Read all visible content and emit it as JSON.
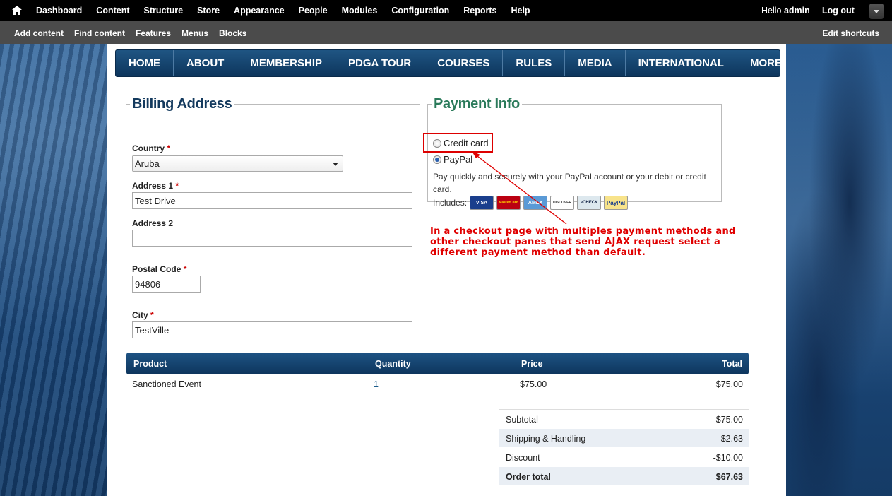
{
  "toolbar": {
    "menu": [
      "Dashboard",
      "Content",
      "Structure",
      "Store",
      "Appearance",
      "People",
      "Modules",
      "Configuration",
      "Reports",
      "Help"
    ],
    "hello": "Hello ",
    "username": "admin",
    "logout": "Log out"
  },
  "shortcuts": {
    "links": [
      "Add content",
      "Find content",
      "Features",
      "Menus",
      "Blocks"
    ],
    "edit": "Edit shortcuts"
  },
  "nav": [
    "HOME",
    "ABOUT",
    "MEMBERSHIP",
    "PDGA TOUR",
    "COURSES",
    "RULES",
    "MEDIA",
    "INTERNATIONAL",
    "MORE"
  ],
  "billing": {
    "legend": "Billing Address",
    "country_label": "Country",
    "country_value": "Aruba",
    "address1_label": "Address 1",
    "address1_value": "Test Drive",
    "address2_label": "Address 2",
    "address2_value": "",
    "postal_label": "Postal Code",
    "postal_value": "94806",
    "city_label": "City",
    "city_value": "TestVille",
    "required_mark": "*"
  },
  "payment": {
    "legend": "Payment Info",
    "options": [
      "Credit card",
      "PayPal"
    ],
    "selected": "PayPal",
    "description": "Pay quickly and securely with your PayPal account or your debit or credit card.",
    "includes_label": "Includes:",
    "cards": [
      "VISA",
      "MasterCard",
      "AMEX",
      "DISCOVER",
      "eCHECK",
      "PayPal"
    ]
  },
  "annotation": "In a checkout page with multiples payment methods and other checkout panes that send AJAX request select a different payment method than default.",
  "products": {
    "headers": [
      "Product",
      "Quantity",
      "Price",
      "Total"
    ],
    "rows": [
      {
        "product": "Sanctioned Event",
        "quantity": "1",
        "price": "$75.00",
        "total": "$75.00"
      }
    ]
  },
  "totals": [
    {
      "label": "Subtotal",
      "value": "$75.00"
    },
    {
      "label": "Shipping & Handling",
      "value": "$2.63"
    },
    {
      "label": "Discount",
      "value": "-$10.00"
    },
    {
      "label": "Order total",
      "value": "$67.63"
    }
  ],
  "colors": {
    "nav": "#0d355c",
    "annotation": "#e00000",
    "billing_legend": "#143a5e",
    "payment_legend": "#2a7a5a"
  }
}
